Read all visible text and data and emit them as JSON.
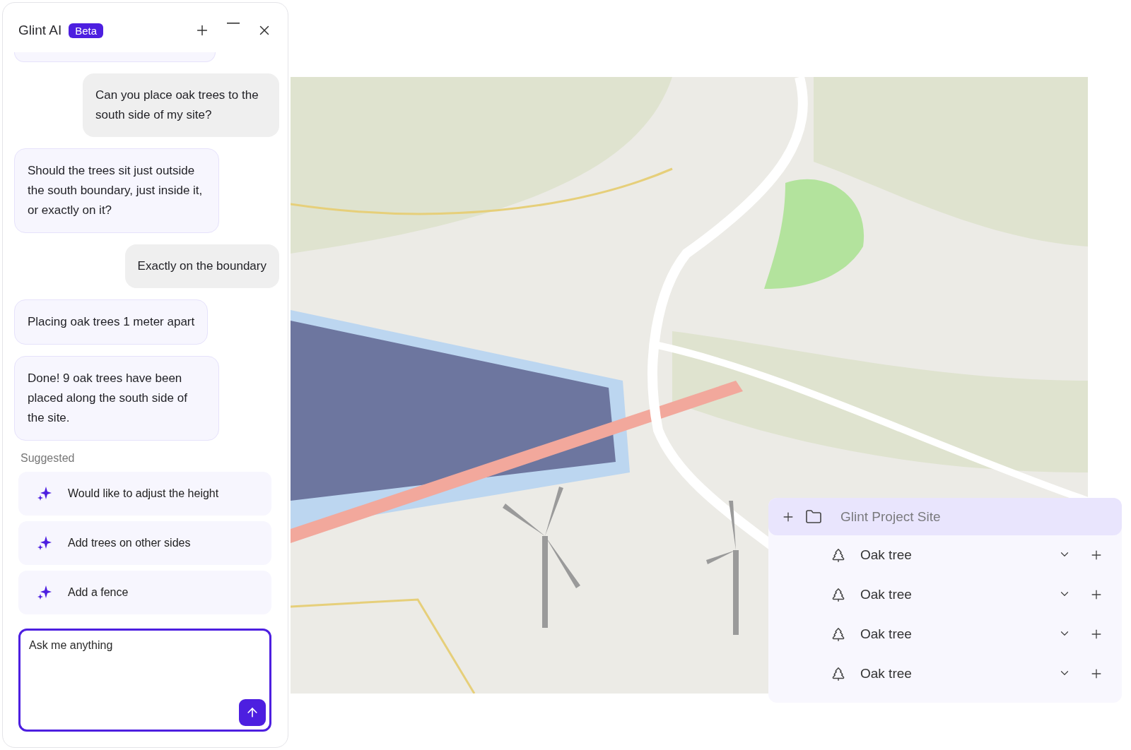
{
  "assistant_panel": {
    "title": "Glint AI",
    "badge": "Beta",
    "messages": [
      {
        "kind": "user",
        "text": "Can you place oak trees to the south side of my site?"
      },
      {
        "kind": "assistant",
        "text": "Should the trees sit just outside the south boundary, just inside it, or exactly on it?"
      },
      {
        "kind": "user",
        "text": "Exactly on the boundary"
      },
      {
        "kind": "assistant",
        "text": "Placing oak trees 1 meter apart"
      },
      {
        "kind": "assistant",
        "text": "Done! 9 oak trees have been placed along the south side of the site."
      }
    ],
    "suggested_heading": "Suggested",
    "suggestions": [
      "Would like to adjust the height",
      "Add trees on other sides",
      "Add a fence"
    ],
    "input": {
      "placeholder": "Ask me anything"
    }
  },
  "layers": {
    "label": "Glint Project Site",
    "selected": true,
    "children": [
      {
        "label": "Oak tree",
        "selected": false
      },
      {
        "label": "Oak tree",
        "selected": false
      },
      {
        "label": "Oak tree",
        "selected": false
      },
      {
        "label": "Oak tree",
        "selected": false
      }
    ]
  }
}
